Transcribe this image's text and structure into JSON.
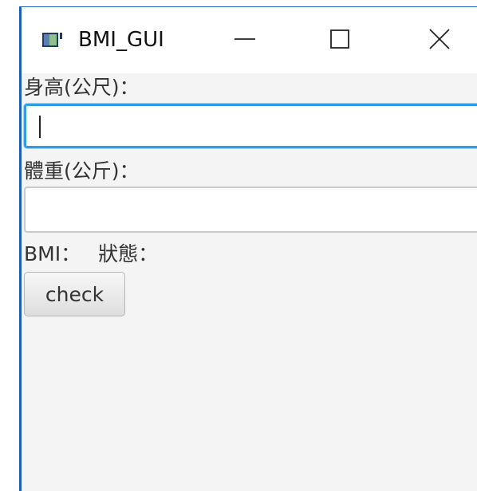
{
  "window": {
    "title": "BMI_GUI",
    "icon": "java-window-icon",
    "controls": {
      "minimize_icon": "minimize-icon",
      "maximize_icon": "maximize-icon",
      "close_icon": "close-icon"
    }
  },
  "form": {
    "height_label": "身高(公尺)：",
    "height_value": "",
    "weight_label": "體重(公斤)：",
    "weight_value": "",
    "bmi_label": "BMI：",
    "status_label": "狀態：",
    "check_label": "check"
  },
  "colors": {
    "focus_border": "#2f9de6",
    "window_border": "#1c5fb8",
    "content_background": "#f4f4f4"
  }
}
